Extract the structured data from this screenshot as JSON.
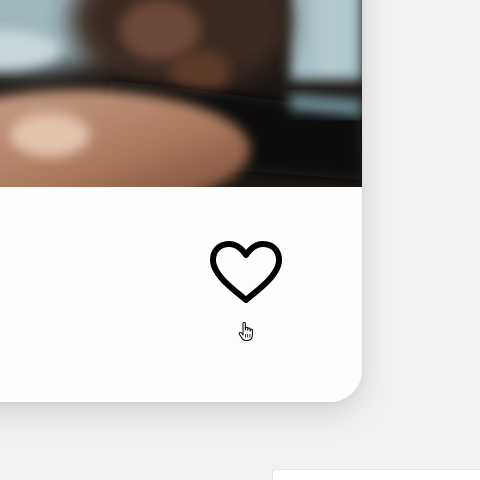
{
  "card": {
    "photo_alt": "",
    "like_icon": "heart-outline-icon",
    "like_icon_color": "#000000",
    "liked": false
  },
  "cursor": {
    "icon": "hand-pointer-cursor-icon"
  },
  "colors": {
    "page_background": "#f1f1f1",
    "card_background": "#fdfdfd"
  }
}
